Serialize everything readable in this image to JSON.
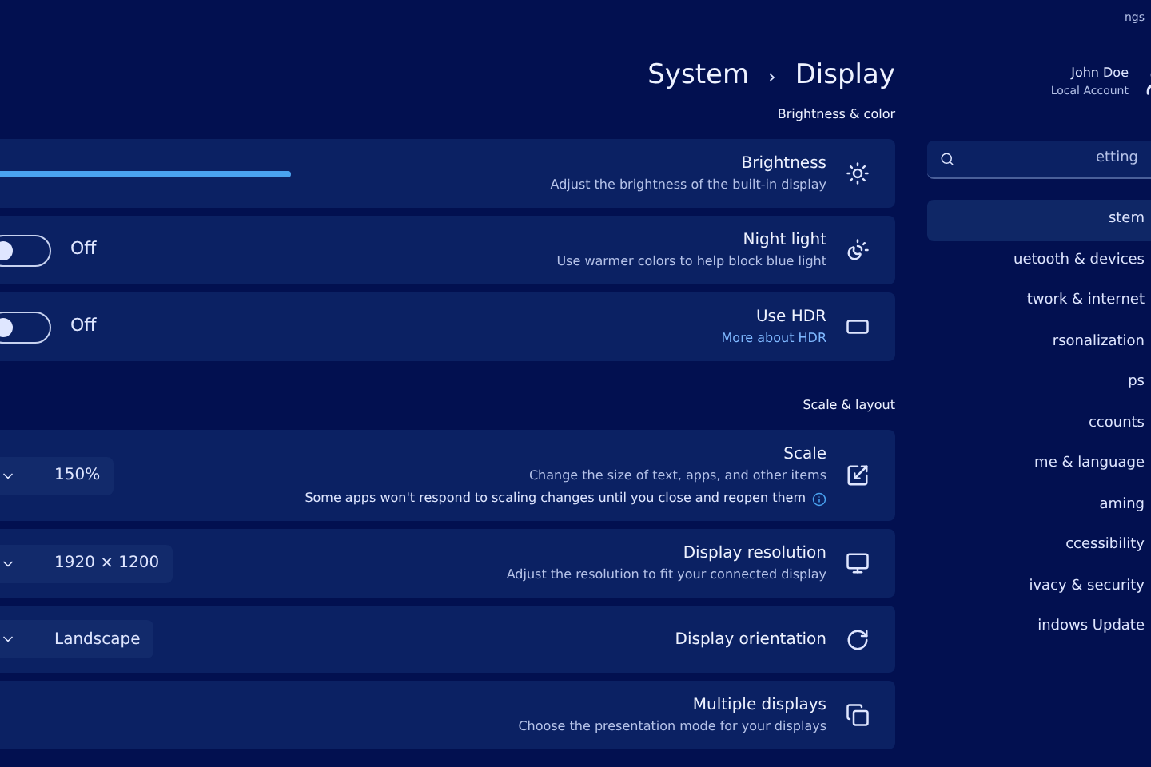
{
  "window": {
    "title": "ngs"
  },
  "account": {
    "name": "John Doe",
    "type": "Local Account"
  },
  "search": {
    "placeholder": "etting"
  },
  "sidebar": {
    "items": [
      {
        "label": "stem",
        "selected": true
      },
      {
        "label": "uetooth & devices",
        "selected": false
      },
      {
        "label": "twork & internet",
        "selected": false
      },
      {
        "label": "rsonalization",
        "selected": false
      },
      {
        "label": "ps",
        "selected": false
      },
      {
        "label": "ccounts",
        "selected": false
      },
      {
        "label": "me & language",
        "selected": false
      },
      {
        "label": "aming",
        "selected": false
      },
      {
        "label": "ccessibility",
        "selected": false
      },
      {
        "label": "ivacy & security",
        "selected": false
      },
      {
        "label": "indows Update",
        "selected": false
      }
    ]
  },
  "breadcrumb": {
    "items": [
      "System",
      "Display"
    ],
    "separator": "›"
  },
  "sections": [
    {
      "title": "Brightness & color",
      "cards": [
        {
          "kind": "slider",
          "title": "Brightness",
          "subtitle": "Adjust the brightness of the built-in display"
        },
        {
          "kind": "toggle",
          "title": "Night light",
          "subtitle": "Use warmer colors to help block blue light",
          "on": false,
          "state": "Off"
        },
        {
          "kind": "toggle",
          "title": "Use HDR",
          "link": "More about HDR",
          "on": false,
          "state": "Off"
        }
      ]
    },
    {
      "title": "Scale & layout",
      "cards": [
        {
          "kind": "dropdown",
          "title": "Scale",
          "subtitle": "Change the size of text, apps, and other items",
          "note": "Some apps won't respond to scaling changes until you close and reopen them",
          "value": "150%"
        },
        {
          "kind": "dropdown",
          "title": "Display resolution",
          "subtitle": "Adjust the resolution to fit your connected display",
          "value": "1920 × 1200"
        },
        {
          "kind": "dropdown",
          "title": "Display orientation",
          "value": "Landscape"
        },
        {
          "kind": "plain",
          "title": "Multiple displays",
          "subtitle": "Choose the presentation mode for your displays"
        }
      ]
    }
  ]
}
